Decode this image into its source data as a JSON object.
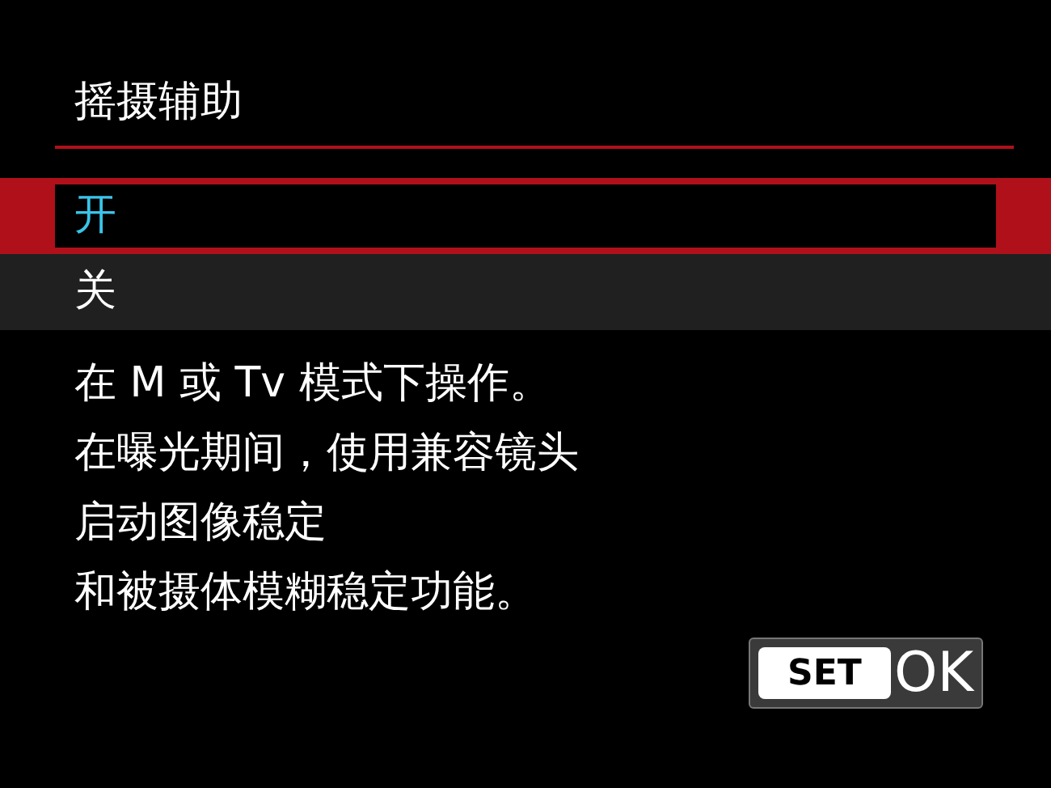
{
  "title": "摇摄辅助",
  "options": [
    {
      "label": "开",
      "selected": true
    },
    {
      "label": "关",
      "selected": false
    }
  ],
  "description": [
    "在 M 或 Tv 模式下操作。",
    "在曝光期间，使用兼容镜头",
    "启动图像稳定",
    "和被摄体模糊稳定功能。"
  ],
  "set_button": {
    "key": "SET",
    "label": "OK"
  }
}
